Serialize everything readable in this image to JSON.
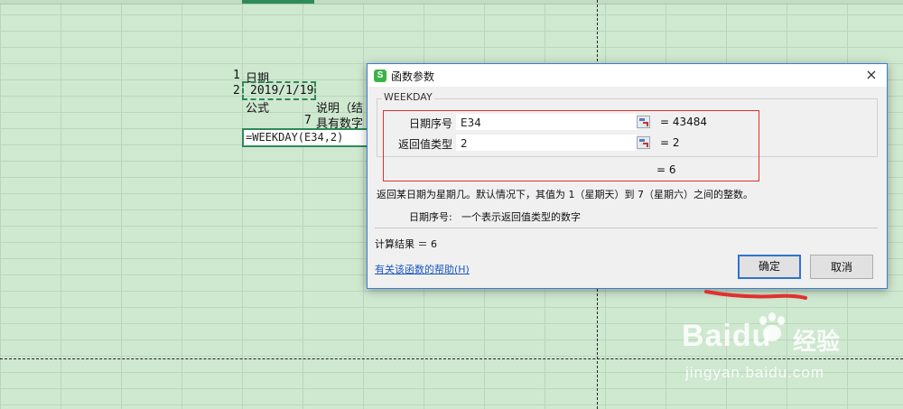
{
  "sheet": {
    "rows": [
      {
        "num": "1",
        "text": "日期"
      },
      {
        "num": "2",
        "text": "2019/1/19"
      }
    ],
    "cells": {
      "formula_header": "公式",
      "desc_header": "说明（结",
      "row_num_7": "7",
      "desc_row": "具有数字",
      "active_formula": "=WEEKDAY(E34,2)"
    }
  },
  "dialog": {
    "title": "函数参数",
    "close_label": "×",
    "app_icon_letter": "S",
    "function_name": "WEEKDAY",
    "args": [
      {
        "label": "日期序号",
        "value": "E34",
        "result": "= 43484"
      },
      {
        "label": "返回值类型",
        "value": "2",
        "result": "= 2"
      }
    ],
    "formula_result": "= 6",
    "description": "返回某日期为星期几。默认情况下，其值为 1（星期天）到 7（星期六）之间的整数。",
    "arg_desc_label": "日期序号:",
    "arg_desc_text": "一个表示返回值类型的数字",
    "calc_result": "计算结果 ＝ 6",
    "help_link": "有关该函数的帮助(H)",
    "ok_label": "确定",
    "cancel_label": "取消"
  },
  "watermark": {
    "logo": "Baidu",
    "chinese": "经验",
    "url": "jingyan.baidu.com"
  },
  "colors": {
    "sheet_bg": "#cfe8d0",
    "selection": "#2e8b57",
    "annotation_red": "#e03030",
    "link": "#1a56c4",
    "default_button_border": "#2f73d3"
  }
}
